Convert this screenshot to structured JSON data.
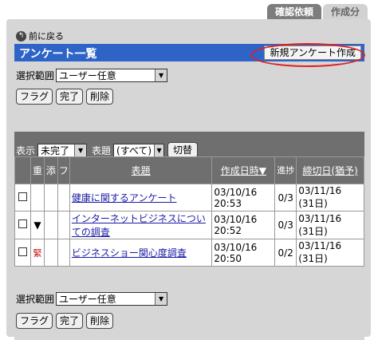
{
  "tabs": [
    {
      "label": "確認依頼",
      "active": true
    },
    {
      "label": "作成分",
      "active": false
    }
  ],
  "back_label": "前に戻る",
  "title": "アンケート一覧",
  "new_button": "新規アンケート作成",
  "range": {
    "label": "選択範囲",
    "value": "ユーザー任意"
  },
  "actions": {
    "flag": "フラグ",
    "done": "完了",
    "delete": "削除"
  },
  "filter": {
    "show_label": "表示",
    "show_value": "未完了",
    "subject_label": "表題",
    "subject_value": "(すべて)",
    "switch_button": "切替"
  },
  "columns": {
    "importance": "重",
    "attach": "添",
    "flag": "フ",
    "subject": "表題",
    "created": "作成日時▼",
    "progress": "進捗",
    "deadline": "締切日(猶予)"
  },
  "rows": [
    {
      "importance": "",
      "subject": "健康に関するアンケート",
      "created_date": "03/10/16",
      "created_time": "20:53",
      "progress": "0/3",
      "deadline_date": "03/11/16",
      "deadline_grace": "(31日)"
    },
    {
      "importance": "▼",
      "subject": "インターネットビジネスについての調査",
      "created_date": "03/10/16",
      "created_time": "20:52",
      "progress": "0/3",
      "deadline_date": "03/11/16",
      "deadline_grace": "(31日)"
    },
    {
      "importance": "緊",
      "subject": "ビジネスショー関心度調査",
      "created_date": "03/10/16",
      "created_time": "20:50",
      "progress": "0/2",
      "deadline_date": "03/11/16",
      "deadline_grace": "(31日)"
    }
  ],
  "colors": {
    "title_bar": "#2e64c8",
    "panel": "#d6d6d6",
    "header": "#6f6f6f",
    "highlight": "#e02020"
  }
}
